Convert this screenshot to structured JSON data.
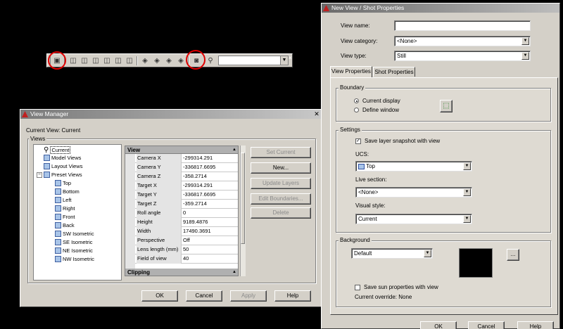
{
  "toolbar": {
    "buttons": [
      "named-views",
      "front-view",
      "back-view",
      "left-view",
      "right-view",
      "top-view",
      "bottom-view",
      "sw-iso",
      "se-iso",
      "ne-iso",
      "nw-iso",
      "camera",
      "zoom"
    ],
    "close_label": "×"
  },
  "view_manager": {
    "title": "View Manager",
    "current_view": "Current View: Current",
    "views_group": "Views",
    "tree": {
      "current": "Current",
      "model_views": "Model Views",
      "layout_views": "Layout Views",
      "preset_views": "Preset Views",
      "presets": [
        "Top",
        "Bottom",
        "Left",
        "Right",
        "Front",
        "Back",
        "SW Isometric",
        "SE Isometric",
        "NE Isometric",
        "NW Isometric"
      ]
    },
    "props_header": "View",
    "props": [
      {
        "k": "Camera X",
        "v": "-299314.291"
      },
      {
        "k": "Camera Y",
        "v": "-336817.6695"
      },
      {
        "k": "Camera Z",
        "v": "-358.2714"
      },
      {
        "k": "Target X",
        "v": "-299314.291"
      },
      {
        "k": "Target Y",
        "v": "-336817.6695"
      },
      {
        "k": "Target Z",
        "v": "-359.2714"
      },
      {
        "k": "Roll angle",
        "v": "0"
      },
      {
        "k": "Height",
        "v": "9189.4876"
      },
      {
        "k": "Width",
        "v": "17490.3691"
      },
      {
        "k": "Perspective",
        "v": "Off"
      },
      {
        "k": "Lens length (mm)",
        "v": "50"
      },
      {
        "k": "Field of view",
        "v": "40"
      }
    ],
    "clipping_header": "Clipping",
    "side_buttons": {
      "set_current": "Set Current",
      "new": "New...",
      "update_layers": "Update Layers",
      "edit_boundaries": "Edit Boundaries...",
      "delete": "Delete"
    },
    "bottom_buttons": {
      "ok": "OK",
      "cancel": "Cancel",
      "apply": "Apply",
      "help": "Help"
    }
  },
  "new_view": {
    "title": "New View / Shot Properties",
    "view_name_label": "View name:",
    "view_name_value": "",
    "view_category_label": "View category:",
    "view_category_value": "<None>",
    "view_type_label": "View type:",
    "view_type_value": "Still",
    "tabs": {
      "view_properties": "View Properties",
      "shot_properties": "Shot Properties"
    },
    "boundary": {
      "group": "Boundary",
      "current_display": "Current display",
      "define_window": "Define window"
    },
    "settings": {
      "group": "Settings",
      "save_layer": "Save layer snapshot with view",
      "ucs_label": "UCS:",
      "ucs_value": "Top",
      "live_section_label": "Live section:",
      "live_section_value": "<None>",
      "visual_style_label": "Visual style:",
      "visual_style_value": "Current"
    },
    "background": {
      "group": "Background",
      "value": "Default",
      "browse": "...",
      "save_sun": "Save sun properties with view",
      "current_override": "Current override: None",
      "swatch_color": "#000000"
    },
    "bottom_buttons": {
      "ok": "OK",
      "cancel": "Cancel",
      "help": "Help"
    }
  },
  "colors": {
    "highlight": "#e00000",
    "desktop": "#000000",
    "dialog": "#d4d0c8"
  }
}
